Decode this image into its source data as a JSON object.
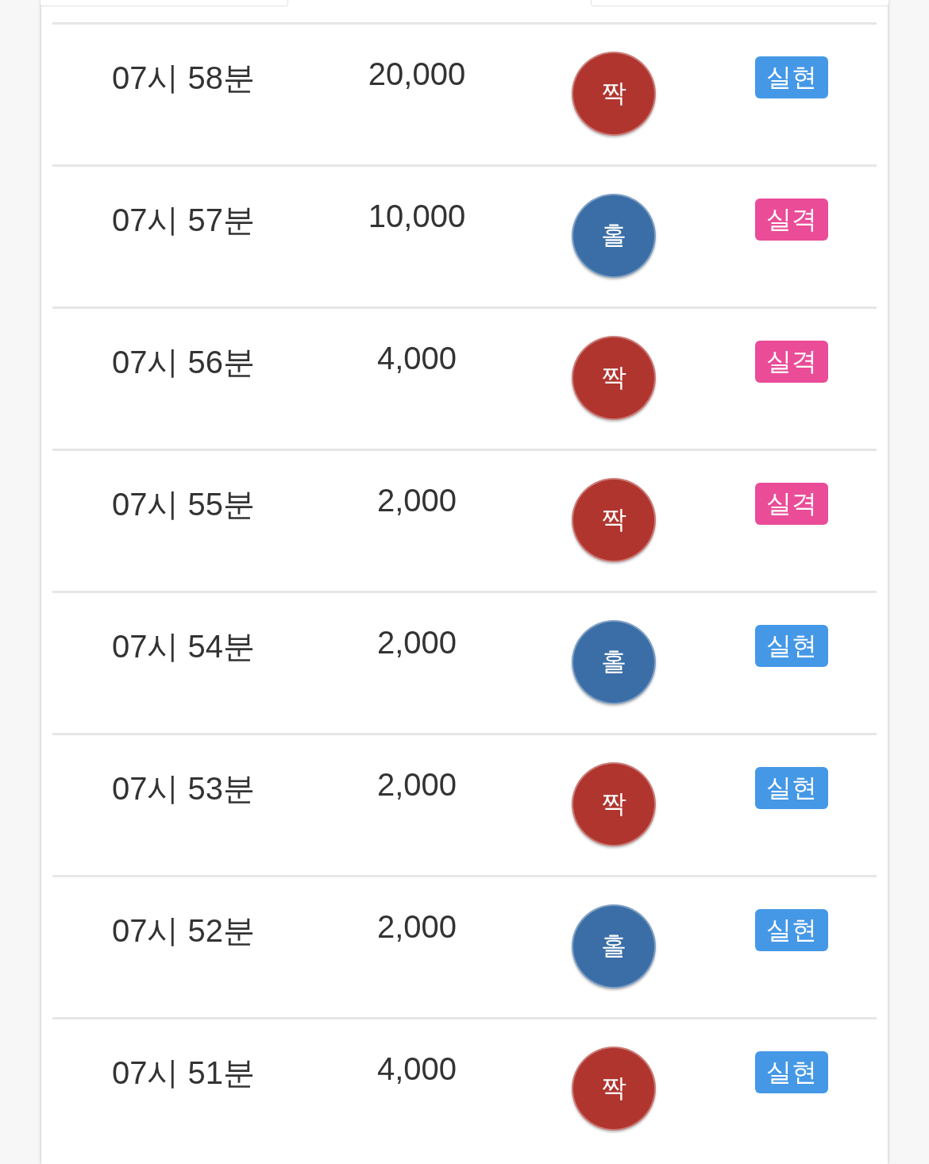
{
  "rows": [
    {
      "time": "07시 58분",
      "amount": "20,000",
      "pick": {
        "label": "짝",
        "kind": "even"
      },
      "result": {
        "label": "실현",
        "kind": "hit"
      }
    },
    {
      "time": "07시 57분",
      "amount": "10,000",
      "pick": {
        "label": "홀",
        "kind": "odd"
      },
      "result": {
        "label": "실격",
        "kind": "miss"
      }
    },
    {
      "time": "07시 56분",
      "amount": "4,000",
      "pick": {
        "label": "짝",
        "kind": "even"
      },
      "result": {
        "label": "실격",
        "kind": "miss"
      }
    },
    {
      "time": "07시 55분",
      "amount": "2,000",
      "pick": {
        "label": "짝",
        "kind": "even"
      },
      "result": {
        "label": "실격",
        "kind": "miss"
      }
    },
    {
      "time": "07시 54분",
      "amount": "2,000",
      "pick": {
        "label": "홀",
        "kind": "odd"
      },
      "result": {
        "label": "실현",
        "kind": "hit"
      }
    },
    {
      "time": "07시 53분",
      "amount": "2,000",
      "pick": {
        "label": "짝",
        "kind": "even"
      },
      "result": {
        "label": "실현",
        "kind": "hit"
      }
    },
    {
      "time": "07시 52분",
      "amount": "2,000",
      "pick": {
        "label": "홀",
        "kind": "odd"
      },
      "result": {
        "label": "실현",
        "kind": "hit"
      }
    },
    {
      "time": "07시 51분",
      "amount": "4,000",
      "pick": {
        "label": "짝",
        "kind": "even"
      },
      "result": {
        "label": "실현",
        "kind": "hit"
      }
    }
  ]
}
